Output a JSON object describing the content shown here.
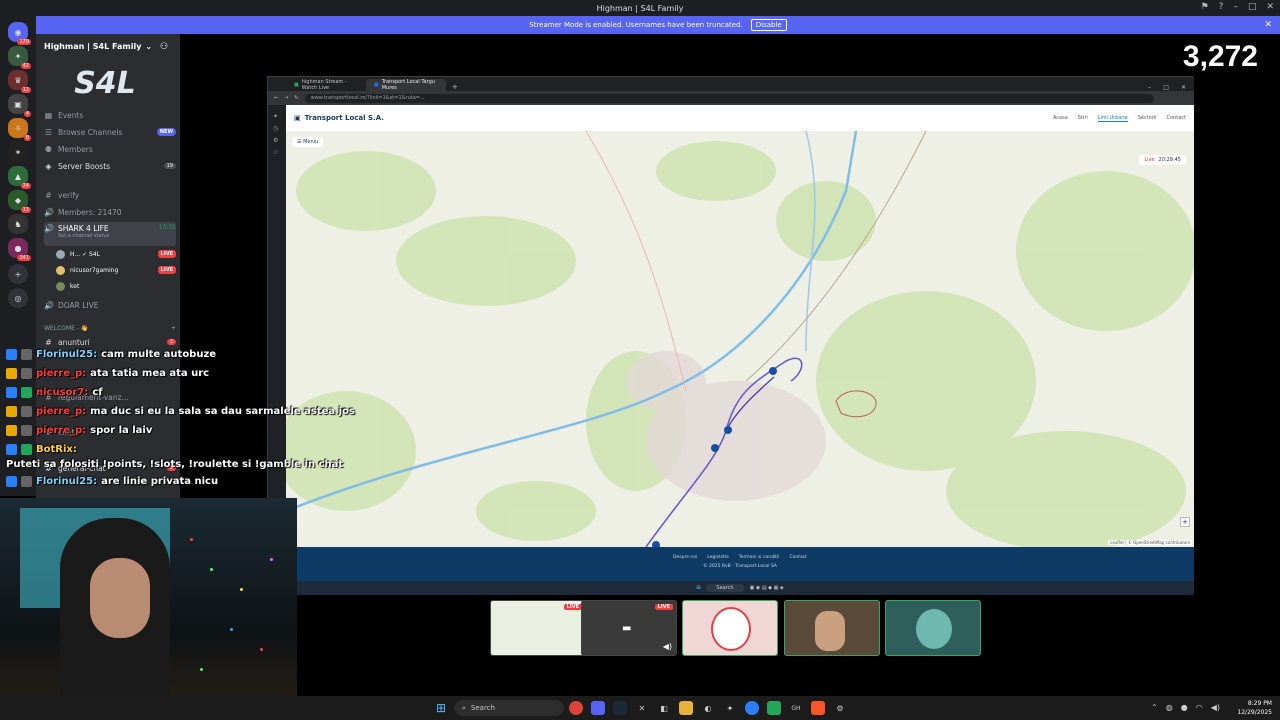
{
  "window": {
    "title": "Highman | S4L Family"
  },
  "streamer": {
    "text": "Streamer Mode is enabled. Usernames have been truncated.",
    "disable": "Disable"
  },
  "servers": {
    "badges": [
      "129",
      "42",
      "12",
      "4",
      "8",
      "24",
      "13",
      "341"
    ]
  },
  "sidebar": {
    "server_name": "Highman | S4L Family",
    "items": [
      {
        "label": "Events"
      },
      {
        "label": "Browse Channels",
        "pill": "NEW"
      },
      {
        "label": "Members"
      },
      {
        "label": "Server Boosts",
        "count": "19"
      }
    ],
    "channels": [
      {
        "label": "verify"
      },
      {
        "label": "Members: 21470"
      },
      {
        "label": "SHARK 4 LIFE",
        "time": "13:31",
        "status": "Set a channel status"
      },
      {
        "label": "DOAR LIVE"
      },
      {
        "label": "WELCOME - 👋"
      },
      {
        "label": "anunturi",
        "count": "2"
      },
      {
        "label": "regulament-vanz..."
      },
      {
        "label": "chat"
      },
      {
        "label": "general-chat",
        "count": "5"
      }
    ],
    "voice_users": [
      {
        "name": "H... ✓ S4L",
        "live": "LIVE"
      },
      {
        "name": "nicusor7gaming",
        "live": "LIVE"
      },
      {
        "name": "ket"
      }
    ]
  },
  "chat": [
    {
      "user": "Florinul25:",
      "text": "cam multe autobuze",
      "color": "#7fd3ff"
    },
    {
      "user": "pierre_p:",
      "text": "ata tatia mea ata urc",
      "color": "#ff3b3b"
    },
    {
      "user": "nicusor7:",
      "text": "cf",
      "color": "#ff3b3b"
    },
    {
      "user": "pierre_p:",
      "text": "ma duc si eu la sala sa dau sarmalele astea jos",
      "color": "#ff3b3b"
    },
    {
      "user": "pierre_p:",
      "text": "spor la laiv",
      "color": "#ff3b3b"
    },
    {
      "user": "BotRix:",
      "text": "Puteti sa folositi !points, !slots, !roulette si !gamble in chat",
      "color": "#ffd23b"
    },
    {
      "user": "Florinul25:",
      "text": "are linie privata nicu",
      "color": "#7fd3ff"
    }
  ],
  "counter": "3,272",
  "browser": {
    "tabs": [
      {
        "label": "highman Stream - Watch Live"
      },
      {
        "label": "Transport Local Targu Mures"
      }
    ],
    "url": "www.transportlocal.ro/?linii=1&st=1&ruta=...",
    "site": {
      "logo": "Transport Local S.A.",
      "nav": [
        "Acasa",
        "Stiri",
        "Linii Urbane",
        "Sectorii",
        "Contact"
      ],
      "active_nav": "Linii Urbane",
      "menu_label": "Meniu",
      "live_label": "Live",
      "time": "20:29:45",
      "footer_links": [
        "Despre noi",
        "Legislatie",
        "Termeni si conditii",
        "Contact"
      ],
      "copyright": "© 2025 BvB - Transport Local SA",
      "attribution": "Leaflet | © OpenStreetMap contributors"
    },
    "inner_search": "Search"
  },
  "thumbs": [
    {
      "live": "LIVE"
    },
    {
      "live": "LIVE"
    },
    {},
    {},
    {}
  ],
  "taskbar": {
    "search": "Search",
    "time": "8:29 PM",
    "date": "12/29/2025"
  }
}
